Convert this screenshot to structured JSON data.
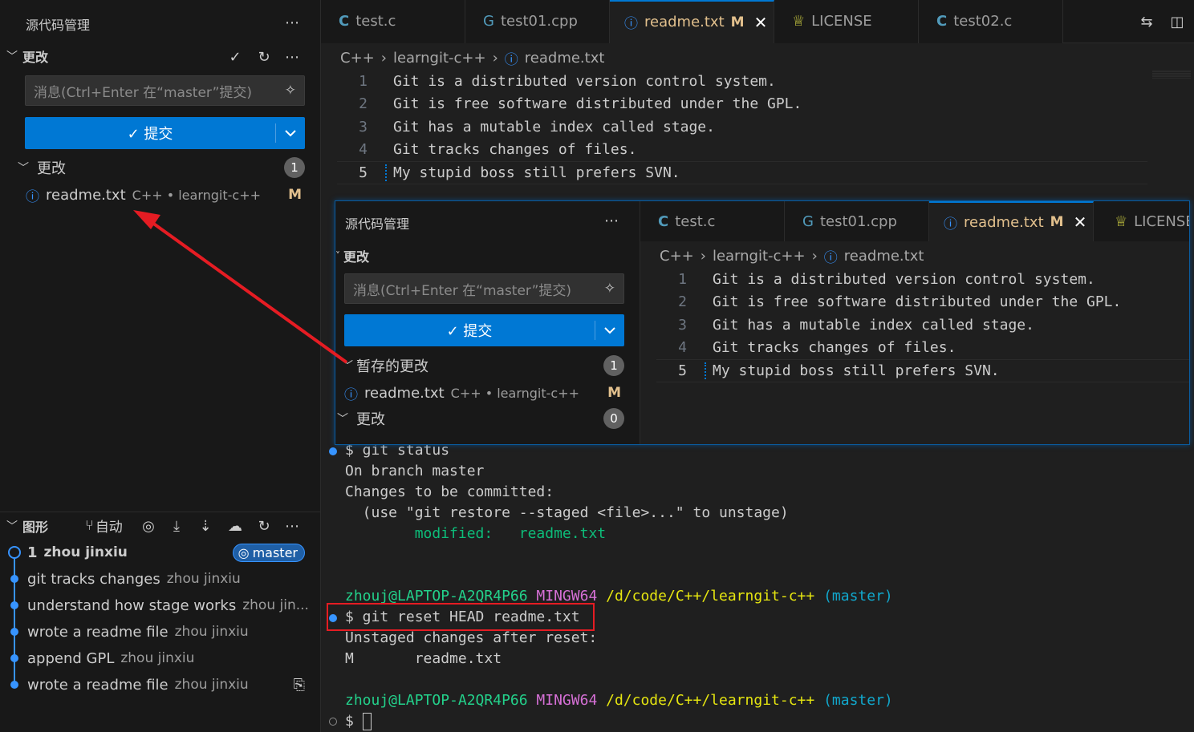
{
  "sidebar": {
    "title": "源代码管理",
    "changes_header": "更改",
    "message_placeholder": "消息(Ctrl+Enter 在“master”提交)",
    "commit_label": "✓ 提交",
    "changes_group": {
      "label": "更改",
      "count": "1"
    },
    "file": {
      "name": "readme.txt",
      "desc": "C++ • learngit-c++",
      "status": "M"
    }
  },
  "graph": {
    "header": "图形",
    "auto_label": "自动",
    "branch": "master",
    "items": [
      {
        "message": "1",
        "author": "zhou jinxiu"
      },
      {
        "message": "git tracks changes",
        "author": "zhou jinxiu"
      },
      {
        "message": "understand how stage works",
        "author": "zhou jin..."
      },
      {
        "message": "wrote a readme file",
        "author": "zhou jinxiu"
      },
      {
        "message": "append GPL",
        "author": "zhou jinxiu"
      },
      {
        "message": "wrote a readme file",
        "author": "zhou jinxiu"
      }
    ]
  },
  "tabs": [
    {
      "label": "test.c"
    },
    {
      "label": "test01.cpp"
    },
    {
      "label": "readme.txt",
      "flag": "M"
    },
    {
      "label": "LICENSE"
    },
    {
      "label": "test02.c"
    }
  ],
  "breadcrumb": {
    "a": "C++",
    "b": "learngit-c++",
    "c": "readme.txt"
  },
  "code": {
    "numbers": [
      "1",
      "2",
      "3",
      "4",
      "5"
    ],
    "lines": [
      "Git is a distributed version control system.",
      "Git is free software distributed under the GPL.",
      "Git has a mutable index called stage.",
      "Git tracks changes of files.",
      "My stupid boss still prefers SVN."
    ]
  },
  "overlay": {
    "title": "源代码管理",
    "changes_header": "更改",
    "message_placeholder": "消息(Ctrl+Enter 在“master”提交)",
    "commit_label": "✓ 提交",
    "staged_group": {
      "label": "暂存的更改",
      "count": "1"
    },
    "file": {
      "name": "readme.txt",
      "desc": "C++ • learngit-c++",
      "status": "M"
    },
    "changes_group": {
      "label": "更改",
      "count": "0"
    },
    "tabs": [
      {
        "label": "test.c"
      },
      {
        "label": "test01.cpp"
      },
      {
        "label": "readme.txt",
        "flag": "M"
      },
      {
        "label": "LICENSE"
      }
    ]
  },
  "terminal": {
    "cmd1": "$ git status",
    "out1": "On branch master",
    "out2": "Changes to be committed:",
    "out3": "  (use \"git restore --staged <file>...\" to unstage)",
    "out4_label": "        modified:",
    "out4_file": "readme.txt",
    "prompt_user": "zhouj@LAPTOP-A2QR4P66",
    "prompt_env": "MINGW64",
    "prompt_path": "/d/code/C++/learngit-c++",
    "prompt_branch": "(master)",
    "cmd2": "$ git reset HEAD readme.txt",
    "out5": "Unstaged changes after reset:",
    "out6": "M       readme.txt",
    "cmd3": "$ "
  },
  "colors": {
    "accent": "#0078d4",
    "highlight_box": "#e51c23",
    "arrow": "#e51c23"
  }
}
